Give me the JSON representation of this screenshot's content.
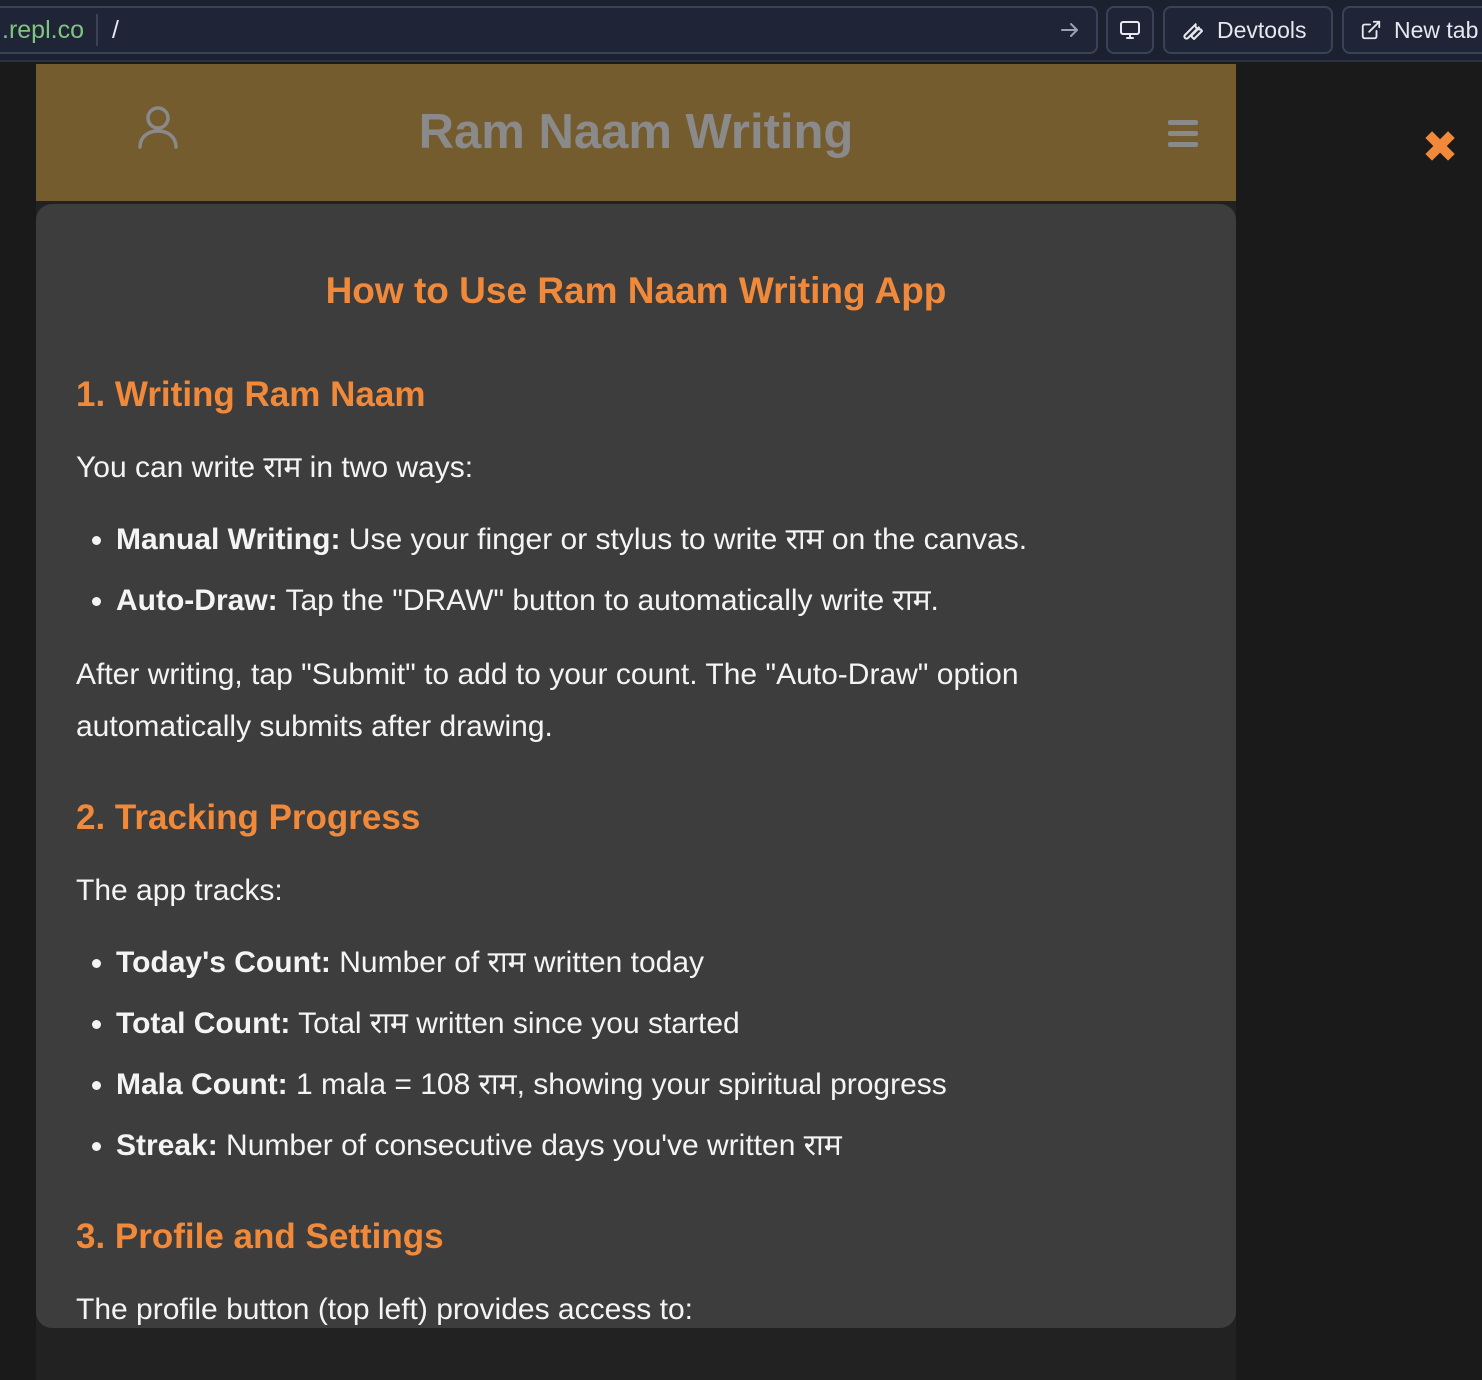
{
  "browser": {
    "url_domain": ".repl.co",
    "url_path": "/",
    "devtools_label": "Devtools",
    "new_tab_label": "New tab"
  },
  "header": {
    "title": "Ram Naam Writing"
  },
  "modal": {
    "close_symbol": "✖",
    "title": "How to Use Ram Naam Writing App",
    "sections": [
      {
        "heading": "1. Writing Ram Naam",
        "intro": "You can write राम in two ways:",
        "items": [
          {
            "label": "Manual Writing:",
            "text": " Use your finger or stylus to write राम on the canvas."
          },
          {
            "label": "Auto-Draw:",
            "text": " Tap the \"DRAW\" button to automatically write राम."
          }
        ],
        "outro": "After writing, tap \"Submit\" to add to your count. The \"Auto-Draw\" option automatically submits after drawing."
      },
      {
        "heading": "2. Tracking Progress",
        "intro": "The app tracks:",
        "items": [
          {
            "label": "Today's Count:",
            "text": " Number of राम written today"
          },
          {
            "label": "Total Count:",
            "text": " Total राम written since you started"
          },
          {
            "label": "Mala Count:",
            "text": " 1 mala = 108 राम, showing your spiritual progress"
          },
          {
            "label": "Streak:",
            "text": " Number of consecutive days you've written राम"
          }
        ]
      },
      {
        "heading": "3. Profile and Settings",
        "intro": "The profile button (top left) provides access to:"
      }
    ]
  },
  "colors": {
    "accent": "#f08a3a",
    "header_bg": "#745c2e",
    "modal_bg": "#3d3d3d",
    "page_bg": "#1a1a1a"
  }
}
